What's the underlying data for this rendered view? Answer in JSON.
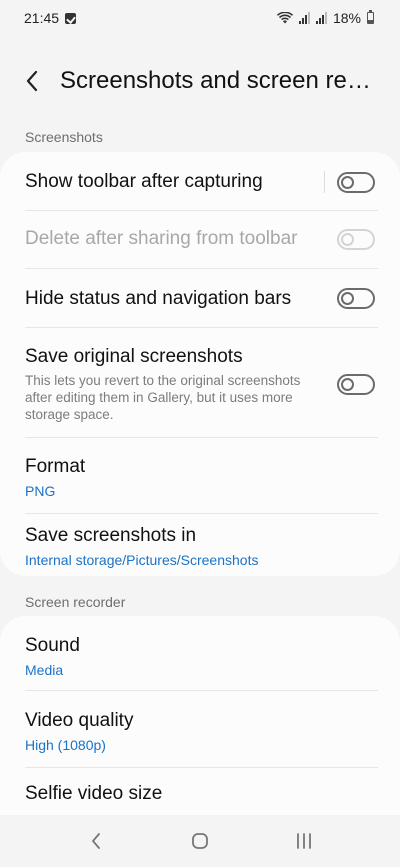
{
  "status_bar": {
    "time": "21:45",
    "battery_percent": "18%"
  },
  "app_bar": {
    "title": "Screenshots and screen rec…"
  },
  "sections": {
    "screenshots": {
      "header": "Screenshots"
    },
    "screen_recorder": {
      "header": "Screen recorder"
    }
  },
  "screenshots_items": {
    "toolbar": {
      "title": "Show toolbar after capturing",
      "enabled": false
    },
    "delete_after_sharing": {
      "title": "Delete after sharing from toolbar",
      "enabled": false,
      "disabled": true
    },
    "hide_bars": {
      "title": "Hide status and navigation bars",
      "enabled": false
    },
    "save_original": {
      "title": "Save original screenshots",
      "description": "This lets you revert to the original screenshots after editing them in Gallery, but it uses more storage space.",
      "enabled": false
    },
    "format": {
      "title": "Format",
      "value": "PNG"
    },
    "save_location": {
      "title": "Save screenshots in",
      "value": "Internal storage/Pictures/Screenshots"
    }
  },
  "recorder_items": {
    "sound": {
      "title": "Sound",
      "value": "Media"
    },
    "video_quality": {
      "title": "Video quality",
      "value": "High (1080p)"
    },
    "selfie_size": {
      "title": "Selfie video size"
    }
  },
  "colors": {
    "accent": "#1a73c8",
    "background": "#f4f4f4",
    "card": "#fcfcfc"
  }
}
